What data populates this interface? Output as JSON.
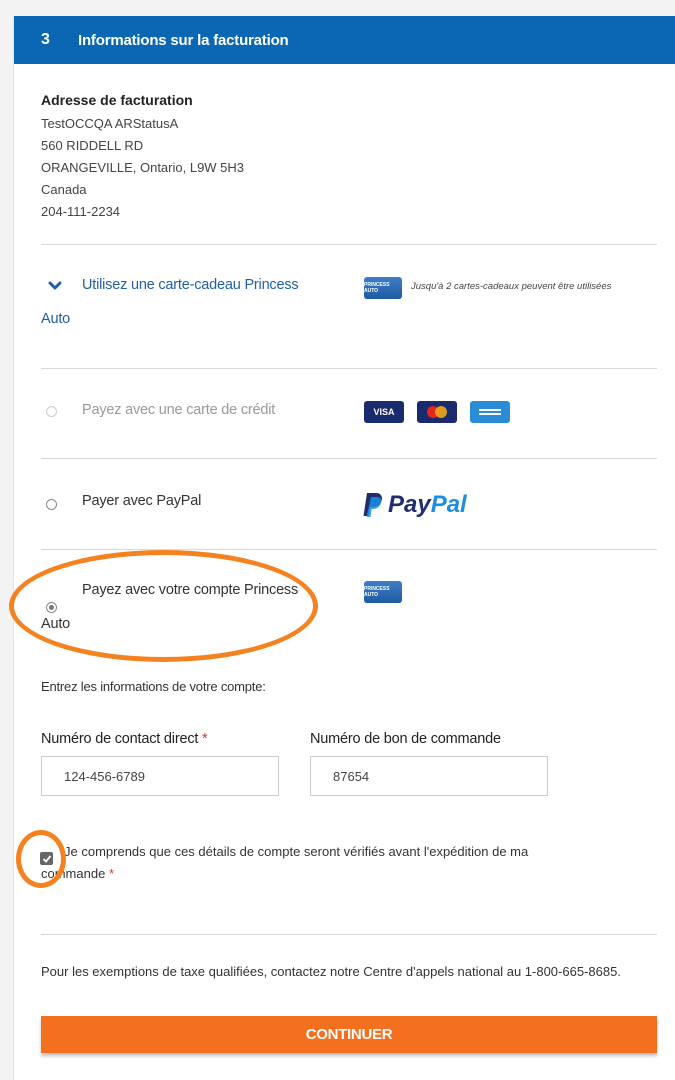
{
  "header": {
    "step": "3",
    "title": "Informations sur la facturation"
  },
  "billing_address": {
    "title": "Adresse de facturation",
    "lines": [
      "TestOCCQA ARStatusA",
      "560 RIDDELL RD",
      "ORANGEVILLE, Ontario, L9W 5H3",
      "Canada",
      "204-111-2234"
    ]
  },
  "gift_card": {
    "label_line1": "Utilisez une carte-cadeau Princess",
    "label_line2": "Auto",
    "note": "Jusqu'à 2 cartes-cadeaux peuvent être utilisées",
    "card_logo_text": "PRINCESS AUTO"
  },
  "payment_options": {
    "credit": {
      "label": "Payez avec une carte de crédit",
      "cards": [
        "VISA",
        "MC",
        "AMEX"
      ]
    },
    "paypal": {
      "label": "Payer avec PayPal",
      "logo_pay": "Pay",
      "logo_pal": "Pal"
    },
    "account": {
      "label_line1": "Payez avec votre compte Princess",
      "label_line2": "Auto",
      "card_logo_text": "PRINCESS AUTO"
    }
  },
  "account_form": {
    "intro": "Entrez les informations de votre compte:",
    "contact_label": "Numéro de contact direct",
    "contact_value": "124-456-6789",
    "po_label": "Numéro de bon de commande",
    "po_value": "87654",
    "required_marker": "*",
    "confirm_text": "Je comprends que ces détails de compte seront vérifiés avant l'expédition de ma commande",
    "confirm_checked": true
  },
  "tax_note": "Pour les exemptions de taxe qualifiées, contactez notre Centre d'appels national au 1-800-665-8685.",
  "continue_label": "CONTINUER",
  "colors": {
    "header": "#0a67b3",
    "accent": "#f46f1e",
    "highlight_ring": "#f58220",
    "link": "#1f5fa8"
  }
}
